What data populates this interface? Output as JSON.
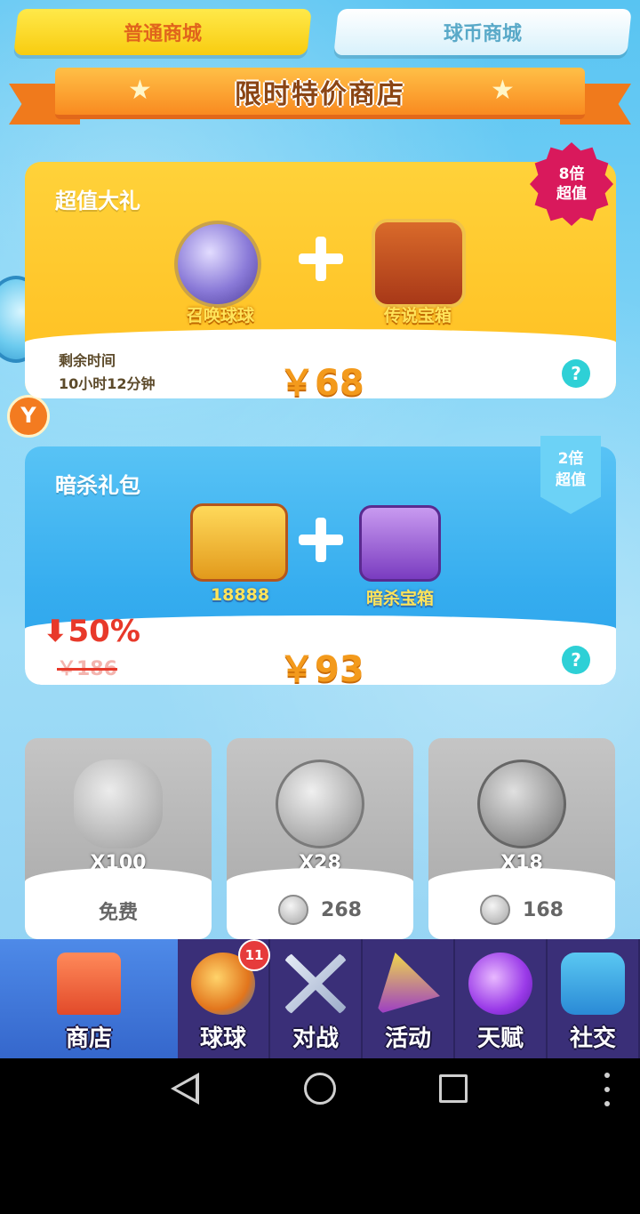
{
  "tabs": {
    "normal_mall": "普通商城",
    "coin_mall": "球币商城"
  },
  "banner": {
    "title": "限时特价商店"
  },
  "deal1": {
    "title": "超值大礼",
    "badge_line1": "8倍",
    "badge_line2": "超值",
    "item1_label": "召唤球球",
    "item2_label": "传说宝箱",
    "timer_label": "剩余时间",
    "timer_value": "10小时12分钟",
    "price": "￥68",
    "help": "?"
  },
  "deal2": {
    "title": "暗杀礼包",
    "badge_line1": "2倍",
    "badge_line2": "超值",
    "item1_label": "18888",
    "item2_label": "暗杀宝箱",
    "discount": "50%",
    "old_price": "￥186",
    "price": "￥93",
    "help": "?"
  },
  "side": {
    "coin_symbol": "Y"
  },
  "tiles": [
    {
      "qty": "X100",
      "cost": "免费"
    },
    {
      "qty": "X28",
      "cost": "268"
    },
    {
      "qty": "X18",
      "cost": "168"
    }
  ],
  "nav": [
    {
      "label": "商店"
    },
    {
      "label": "球球",
      "badge": "11"
    },
    {
      "label": "对战"
    },
    {
      "label": "活动"
    },
    {
      "label": "天赋"
    },
    {
      "label": "社交"
    }
  ],
  "colors": {
    "accent_orange": "#f39a1c",
    "nav_bg": "#3a2f78",
    "nav_active": "#4e8ae8"
  }
}
